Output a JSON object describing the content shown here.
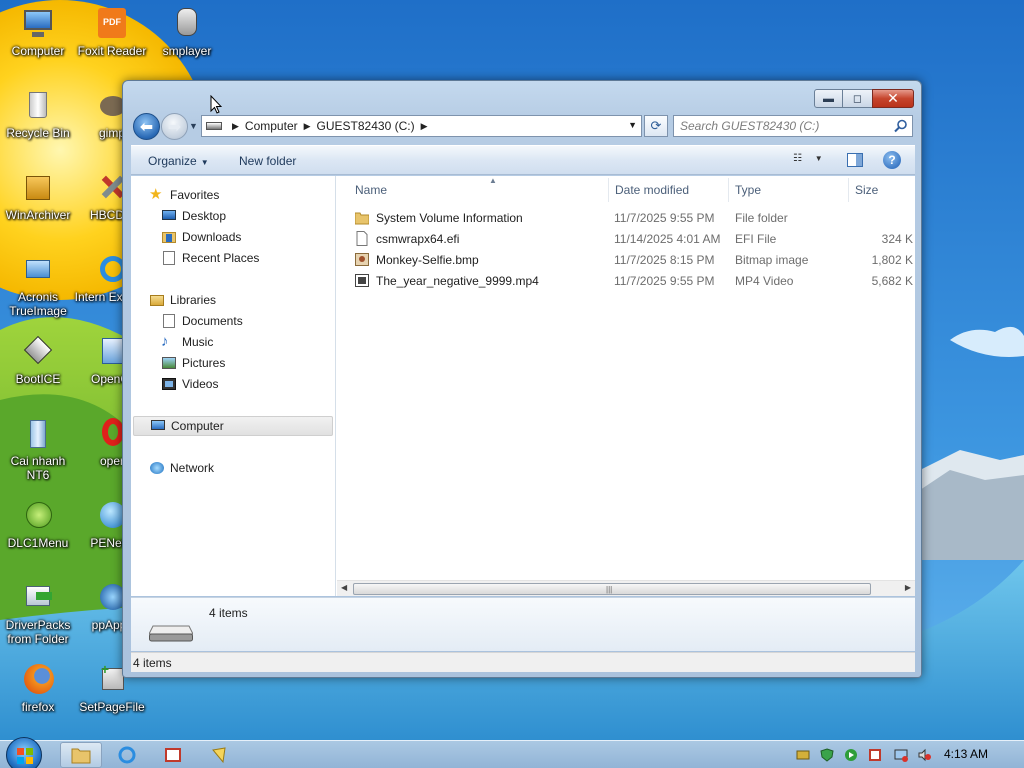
{
  "desktop": {
    "icons": [
      {
        "label": "Computer"
      },
      {
        "label": "Foxit Reader"
      },
      {
        "label": "smplayer"
      },
      {
        "label": "Recycle Bin"
      },
      {
        "label": "gimp"
      },
      {
        "label": "WinArchiver"
      },
      {
        "label": "HBCDM"
      },
      {
        "label": "Acronis TrueImage"
      },
      {
        "label": "Intern Explore"
      },
      {
        "label": "BootICE"
      },
      {
        "label": "OpenOf"
      },
      {
        "label": "Cai nhanh NT6"
      },
      {
        "label": "oper"
      },
      {
        "label": "DLC1Menu"
      },
      {
        "label": "PENetw"
      },
      {
        "label": "DriverPacks from Folder"
      },
      {
        "label": "ppApps"
      },
      {
        "label": "firefox"
      },
      {
        "label": "SetPageFile"
      }
    ]
  },
  "window": {
    "caption_buttons": {
      "minimize": "▬",
      "maximize": "◻",
      "close": "✕"
    },
    "breadcrumb": [
      "Computer",
      "GUEST82430 (C:)"
    ],
    "search_placeholder": "Search GUEST82430 (C:)",
    "toolbar": {
      "organize": "Organize",
      "new_folder": "New folder"
    },
    "nav": {
      "favorites": "Favorites",
      "favorites_items": [
        "Desktop",
        "Downloads",
        "Recent Places"
      ],
      "libraries": "Libraries",
      "libraries_items": [
        "Documents",
        "Music",
        "Pictures",
        "Videos"
      ],
      "computer": "Computer",
      "network": "Network"
    },
    "columns": {
      "name": "Name",
      "date": "Date modified",
      "type": "Type",
      "size": "Size"
    },
    "files": [
      {
        "name": "System Volume Information",
        "date": "11/7/2025 9:55 PM",
        "type": "File folder",
        "size": "",
        "icon": "folder-icon"
      },
      {
        "name": "csmwrapx64.efi",
        "date": "11/14/2025 4:01 AM",
        "type": "EFI File",
        "size": "324 K",
        "icon": "file-icon"
      },
      {
        "name": "Monkey-Selfie.bmp",
        "date": "11/7/2025 8:15 PM",
        "type": "Bitmap image",
        "size": "1,802 K",
        "icon": "bitmap-icon"
      },
      {
        "name": "The_year_negative_9999.mp4",
        "date": "11/7/2025 9:55 PM",
        "type": "MP4 Video",
        "size": "5,682 K",
        "icon": "video-icon"
      }
    ],
    "details_count": "4 items",
    "status": "4 items"
  },
  "taskbar": {
    "clock": "4:13 AM"
  },
  "colors": {
    "accent": "#2a6cc0",
    "window_frame": "#b6cce4",
    "close_button": "#c6452d"
  }
}
